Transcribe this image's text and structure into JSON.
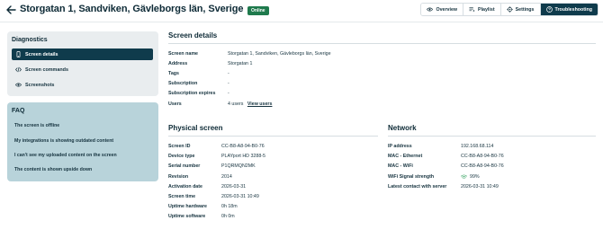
{
  "header": {
    "title": "Storgatan 1, Sandviken, Gävleborgs län, Sverige",
    "status_badge": "Online",
    "tabs": [
      {
        "label": "Overview",
        "icon": "eye-icon"
      },
      {
        "label": "Playlist",
        "icon": "playlist-icon"
      },
      {
        "label": "Settings",
        "icon": "gear-icon"
      },
      {
        "label": "Troubleshooting",
        "icon": "help-circle-icon",
        "active": true
      }
    ]
  },
  "sidebar": {
    "heading": "Diagnostics",
    "items": [
      {
        "label": "Screen details",
        "icon": "device-icon",
        "active": true
      },
      {
        "label": "Screen commands",
        "icon": "code-icon"
      },
      {
        "label": "Screenshots",
        "icon": "eye-icon"
      }
    ]
  },
  "faq": {
    "heading": "FAQ",
    "items": [
      "The screen is offline",
      "My integrations is showing outdated content",
      "I can't see my uploaded content on the screen",
      "The content is shown upside down"
    ]
  },
  "screen_details": {
    "title": "Screen details",
    "rows": [
      {
        "label": "Screen name",
        "value": "Storgatan 1, Sandviken, Gävleborgs län, Sverige"
      },
      {
        "label": "Address",
        "value": "Storgatan 1"
      },
      {
        "label": "Tags",
        "value": "-"
      },
      {
        "label": "Subscription",
        "value": "-"
      },
      {
        "label": "Subscription expires",
        "value": "-"
      },
      {
        "label": "Users",
        "value": "4 users",
        "link": "View users"
      }
    ]
  },
  "physical_screen": {
    "title": "Physical screen",
    "rows": [
      {
        "label": "Screen ID",
        "value": "CC-B8-A8-94-B0-76"
      },
      {
        "label": "Device type",
        "value": "PLAYport HD 3288-5"
      },
      {
        "label": "Serial number",
        "value": "P1QRMQN2MK"
      },
      {
        "label": "Revision",
        "value": "2014"
      },
      {
        "label": "Activation date",
        "value": "2026-03-31"
      },
      {
        "label": "Screen time",
        "value": "2026-03-31 10:49"
      },
      {
        "label": "Uptime hardware",
        "value": "0h 18m"
      },
      {
        "label": "Uptime software",
        "value": "0h 0m"
      }
    ]
  },
  "network": {
    "title": "Network",
    "rows": [
      {
        "label": "IP address",
        "value": "192.168.68.114"
      },
      {
        "label": "MAC - Ethernet",
        "value": "CC-B8-A8-94-B0-76"
      },
      {
        "label": "MAC - WiFi",
        "value": "CC-B8-A8-94-B0-76"
      },
      {
        "label": "WiFi Signal strength",
        "value": "99%",
        "icon": "wifi-icon"
      },
      {
        "label": "Latest contact with server",
        "value": "2026-03-31 10:49"
      }
    ]
  },
  "colors": {
    "accent": "#0f3b4c",
    "online": "#1f7a4d",
    "faq_bg": "#b8d3da",
    "panel_bg": "#e9edef",
    "wifi": "#2e9e5b"
  }
}
